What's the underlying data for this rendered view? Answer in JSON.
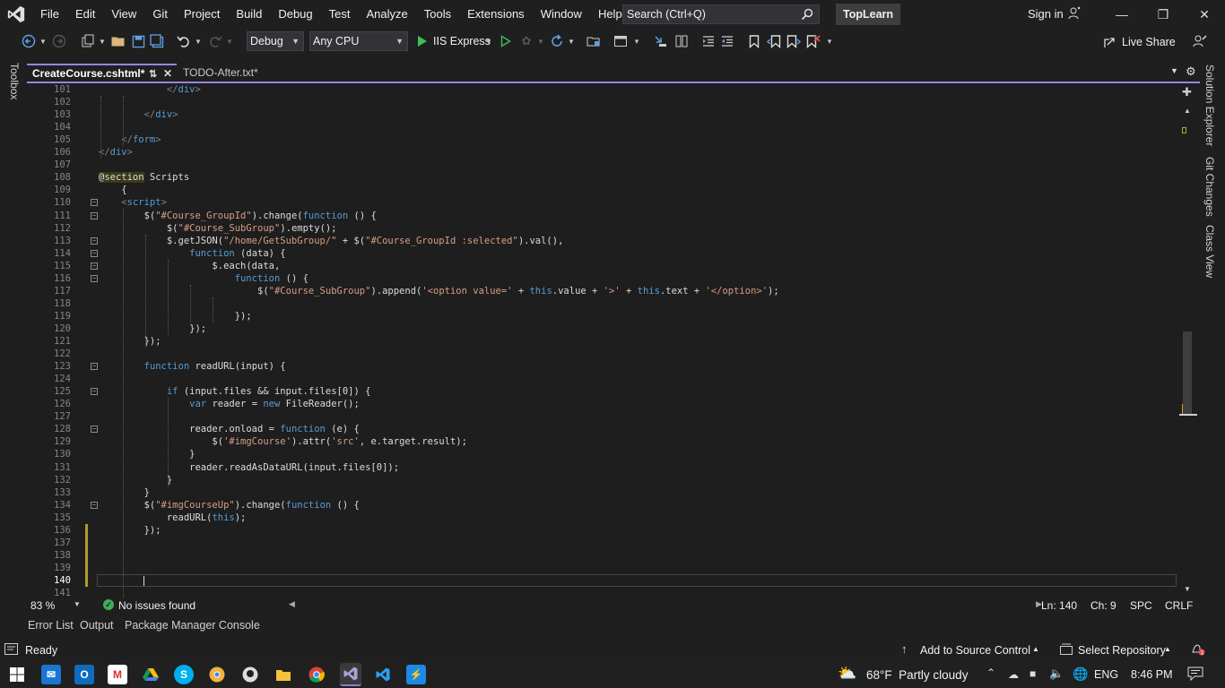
{
  "menu": [
    "File",
    "Edit",
    "View",
    "Git",
    "Project",
    "Build",
    "Debug",
    "Test",
    "Analyze",
    "Tools",
    "Extensions",
    "Window",
    "Help"
  ],
  "search": {
    "placeholder": "Search (Ctrl+Q)"
  },
  "solution_name": "TopLearn",
  "account": {
    "signin": "Sign in"
  },
  "toolbar": {
    "config": "Debug",
    "platform": "Any CPU",
    "run_target": "IIS Express",
    "live_share": "Live Share"
  },
  "left_strip": {
    "toolbox": "Toolbox"
  },
  "tabs": [
    {
      "label": "CreateCourse.cshtml*",
      "active": true
    },
    {
      "label": "TODO-After.txt*",
      "active": false
    }
  ],
  "side_panels": [
    "Solution Explorer",
    "Git Changes",
    "Class View"
  ],
  "editor": {
    "current_line": 140,
    "lines": [
      {
        "n": 101,
        "text": "            </div>"
      },
      {
        "n": 102,
        "text": ""
      },
      {
        "n": 103,
        "text": "        </div>"
      },
      {
        "n": 104,
        "text": ""
      },
      {
        "n": 105,
        "text": "    </form>"
      },
      {
        "n": 106,
        "text": "</div>"
      },
      {
        "n": 107,
        "text": ""
      },
      {
        "n": 108,
        "text": "@section Scripts"
      },
      {
        "n": 109,
        "text": "    {"
      },
      {
        "n": 110,
        "text": "    <script>"
      },
      {
        "n": 111,
        "text": "        $(\"#Course_GroupId\").change(function () {"
      },
      {
        "n": 112,
        "text": "            $(\"#Course_SubGroup\").empty();"
      },
      {
        "n": 113,
        "text": "            $.getJSON(\"/home/GetSubGroup/\" + $(\"#Course_GroupId :selected\").val(),"
      },
      {
        "n": 114,
        "text": "                function (data) {"
      },
      {
        "n": 115,
        "text": "                    $.each(data,"
      },
      {
        "n": 116,
        "text": "                        function () {"
      },
      {
        "n": 117,
        "text": "                            $(\"#Course_SubGroup\").append('<option value=' + this.value + '>' + this.text + '</option>');"
      },
      {
        "n": 118,
        "text": ""
      },
      {
        "n": 119,
        "text": "                        });"
      },
      {
        "n": 120,
        "text": "                });"
      },
      {
        "n": 121,
        "text": "        });"
      },
      {
        "n": 122,
        "text": ""
      },
      {
        "n": 123,
        "text": "        function readURL(input) {"
      },
      {
        "n": 124,
        "text": ""
      },
      {
        "n": 125,
        "text": "            if (input.files && input.files[0]) {"
      },
      {
        "n": 126,
        "text": "                var reader = new FileReader();"
      },
      {
        "n": 127,
        "text": ""
      },
      {
        "n": 128,
        "text": "                reader.onload = function (e) {"
      },
      {
        "n": 129,
        "text": "                    $('#imgCourse').attr('src', e.target.result);"
      },
      {
        "n": 130,
        "text": "                }"
      },
      {
        "n": 131,
        "text": "                reader.readAsDataURL(input.files[0]);"
      },
      {
        "n": 132,
        "text": "            }"
      },
      {
        "n": 133,
        "text": "        }"
      },
      {
        "n": 134,
        "text": "        $(\"#imgCourseUp\").change(function () {"
      },
      {
        "n": 135,
        "text": "            readURL(this);"
      },
      {
        "n": 136,
        "text": "        });"
      },
      {
        "n": 137,
        "text": ""
      },
      {
        "n": 138,
        "text": ""
      },
      {
        "n": 139,
        "text": ""
      },
      {
        "n": 140,
        "text": "        "
      },
      {
        "n": 141,
        "text": ""
      }
    ]
  },
  "editor_status": {
    "zoom": "83 %",
    "issues": "No issues found",
    "line": "Ln: 140",
    "col": "Ch: 9",
    "whitespace": "SPC",
    "line_ending": "CRLF"
  },
  "bottom_tabs": [
    "Error List",
    "Output",
    "Package Manager Console"
  ],
  "status": {
    "ready": "Ready",
    "source_control": "Add to Source Control",
    "repository": "Select Repository"
  },
  "taskbar": {
    "weather": "68°F  Partly cloudy",
    "language": "ENG",
    "time": "8:46 PM",
    "apps": [
      "Start",
      "Mail",
      "Outlook",
      "Gmail",
      "Google Drive",
      "Skype",
      "Chrome Canary",
      "GitHub",
      "File Explorer",
      "Chrome",
      "Visual Studio",
      "VS Code",
      "Bolt"
    ]
  }
}
